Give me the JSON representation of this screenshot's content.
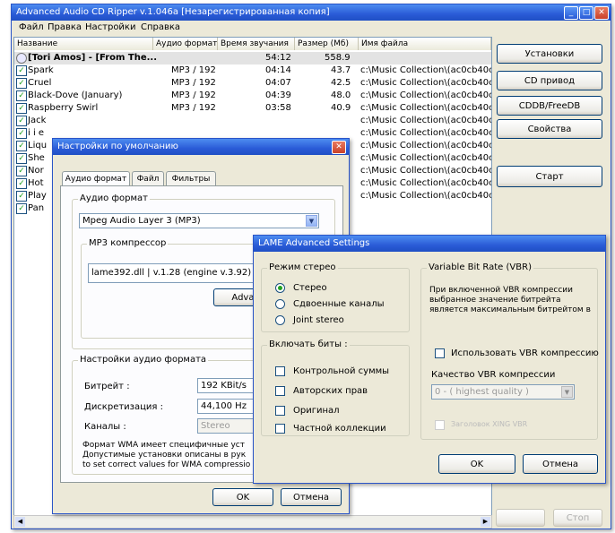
{
  "main": {
    "title": "Advanced Audio CD Ripper v.1.046a [Незарегистрированная копия]",
    "menu": [
      "Файл",
      "Правка",
      "Настройки",
      "Справка"
    ],
    "columns": [
      "Название",
      "Аудио формат",
      "Время звучания",
      "Размер (Мб)",
      "Имя файла"
    ],
    "album_row": {
      "name": "[Tori Amos] - [From The...",
      "duration": "54:12",
      "size": "558.9"
    },
    "tracks": [
      {
        "name": "Spark",
        "format": "MP3 / 192",
        "duration": "04:14",
        "size": "43.7",
        "file": "c:\\Music Collection\\(ac0cb40c)"
      },
      {
        "name": "Cruel",
        "format": "MP3 / 192",
        "duration": "04:07",
        "size": "42.5",
        "file": "c:\\Music Collection\\(ac0cb40c)"
      },
      {
        "name": "Black-Dove (January)",
        "format": "MP3 / 192",
        "duration": "04:39",
        "size": "48.0",
        "file": "c:\\Music Collection\\(ac0cb40c)"
      },
      {
        "name": "Raspberry Swirl",
        "format": "MP3 / 192",
        "duration": "03:58",
        "size": "40.9",
        "file": "c:\\Music Collection\\(ac0cb40c)"
      },
      {
        "name": "Jack",
        "format": "",
        "duration": "",
        "size": "",
        "file": "c:\\Music Collection\\(ac0cb40c)"
      },
      {
        "name": "i i e",
        "format": "",
        "duration": "",
        "size": "",
        "file": "c:\\Music Collection\\(ac0cb40c)"
      },
      {
        "name": "Liqu",
        "format": "",
        "duration": "",
        "size": "",
        "file": "c:\\Music Collection\\(ac0cb40c)"
      },
      {
        "name": "She",
        "format": "",
        "duration": "",
        "size": "",
        "file": "c:\\Music Collection\\(ac0cb40c)"
      },
      {
        "name": "Nor",
        "format": "",
        "duration": "",
        "size": "",
        "file": "c:\\Music Collection\\(ac0cb40c)"
      },
      {
        "name": "Hot",
        "format": "",
        "duration": "",
        "size": "",
        "file": "c:\\Music Collection\\(ac0cb40c)"
      },
      {
        "name": "Play",
        "format": "",
        "duration": "",
        "size": "",
        "file": "c:\\Music Collection\\(ac0cb40c)"
      },
      {
        "name": "Pan",
        "format": "",
        "duration": "",
        "size": "",
        "file": ""
      }
    ],
    "buttons": {
      "settings": "Установки",
      "cd_drive": "CD привод",
      "cddb": "CDDB/FreeDB",
      "properties": "Свойства",
      "start": "Старт",
      "stop": "Стоп"
    }
  },
  "defaults_dialog": {
    "title": "Настройки по умолчанию",
    "tabs": [
      "Аудио формат",
      "Файл",
      "Фильтры"
    ],
    "audio_format_group": "Аудио формат",
    "format_value": "Mpeg Audio Layer 3 (MP3)",
    "compressor_group": "MP3 компрессор",
    "compressor_value": "lame392.dll | v.1.28 (engine v.3.92)",
    "advanced_button": "Advar",
    "format_settings_group": "Настройки аудио формата",
    "bitrate_label": "Битрейт :",
    "bitrate_value": "192 KBit/s",
    "sample_label": "Дискретизация :",
    "sample_value": "44,100 Hz",
    "channels_label": "Каналы :",
    "channels_value": "Stereo",
    "note_lines": [
      "Формат WMA имеет специфичные уст",
      "Допустимые установки описаны в рук",
      "to set correct values for WMA compressio"
    ],
    "ok": "OK",
    "cancel": "Отмена"
  },
  "lame_dialog": {
    "title": "LAME Advanced Settings",
    "stereo_group": "Режим стерео",
    "stereo_options": [
      "Стерео",
      "Сдвоенные каналы",
      "Joint stereo"
    ],
    "stereo_selected": 0,
    "bits_group": "Включать биты :",
    "bits_options": [
      "Контрольной суммы",
      "Авторских прав",
      "Оригинал",
      "Частной коллекции"
    ],
    "vbr_group": "Variable Bit Rate (VBR)",
    "vbr_note": [
      "При включенной VBR компрессии",
      "выбранное значение битрейта",
      "является максимальным битрейтом в"
    ],
    "vbr_use": "Использовать VBR компрессию",
    "vbr_quality_label": "Качество VBR компрессии",
    "vbr_quality_value": "0 - ( highest quality )",
    "xing_header": "Заголовок XING VBR",
    "ok": "OK",
    "cancel": "Отмена"
  }
}
